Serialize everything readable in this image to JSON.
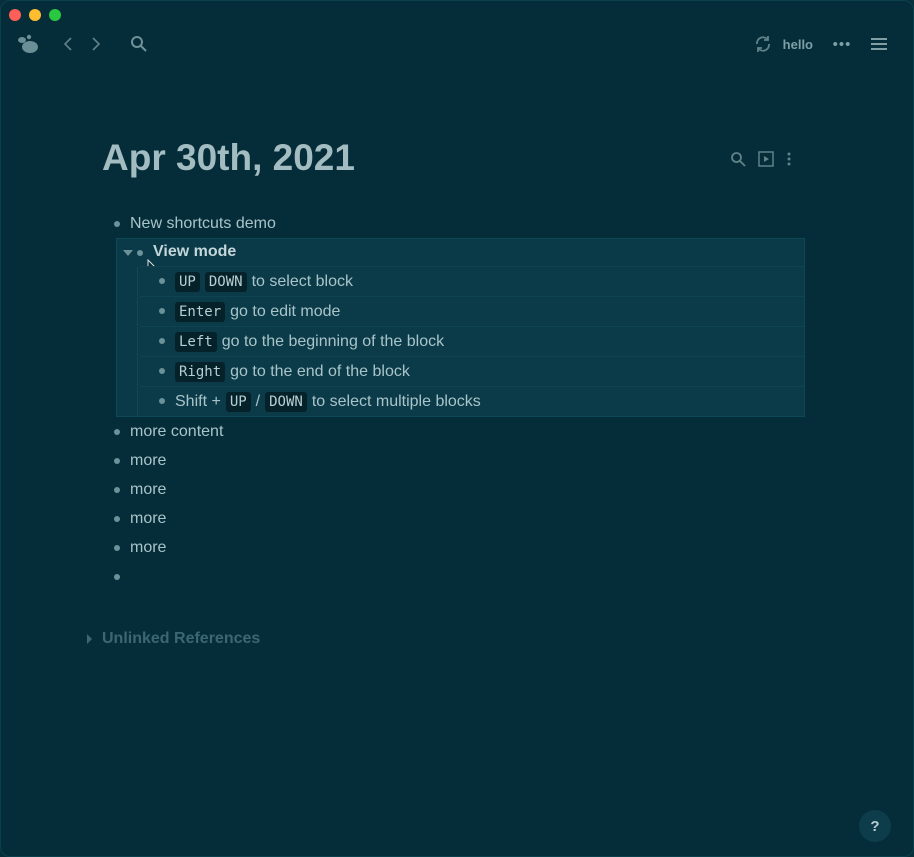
{
  "toolbar": {
    "logo_icon": "logseq-logo-icon",
    "repo_name": "hello",
    "more_label": "•••"
  },
  "page": {
    "title": "Apr 30th, 2021"
  },
  "blocks": {
    "first": "New shortcuts demo",
    "selected_title": "View mode",
    "children": [
      {
        "keys": [
          "UP",
          "DOWN"
        ],
        "text": "to select block"
      },
      {
        "keys": [
          "Enter"
        ],
        "text": "go to edit mode"
      },
      {
        "keys": [
          "Left"
        ],
        "text": "go to the beginning of the block"
      },
      {
        "keys": [
          "Right"
        ],
        "text": "go to the end of the block"
      },
      {
        "prefix": "Shift +",
        "keys": [
          "UP",
          "DOWN"
        ],
        "separator": "/",
        "text": "to select multiple blocks"
      }
    ],
    "after": [
      "more content",
      "more",
      "more",
      "more",
      "more",
      ""
    ]
  },
  "references": {
    "label": "Unlinked References"
  },
  "help": {
    "label": "?"
  },
  "colors": {
    "background": "#052d39",
    "selection": "#0a3947",
    "text": "#a9c4c9"
  }
}
